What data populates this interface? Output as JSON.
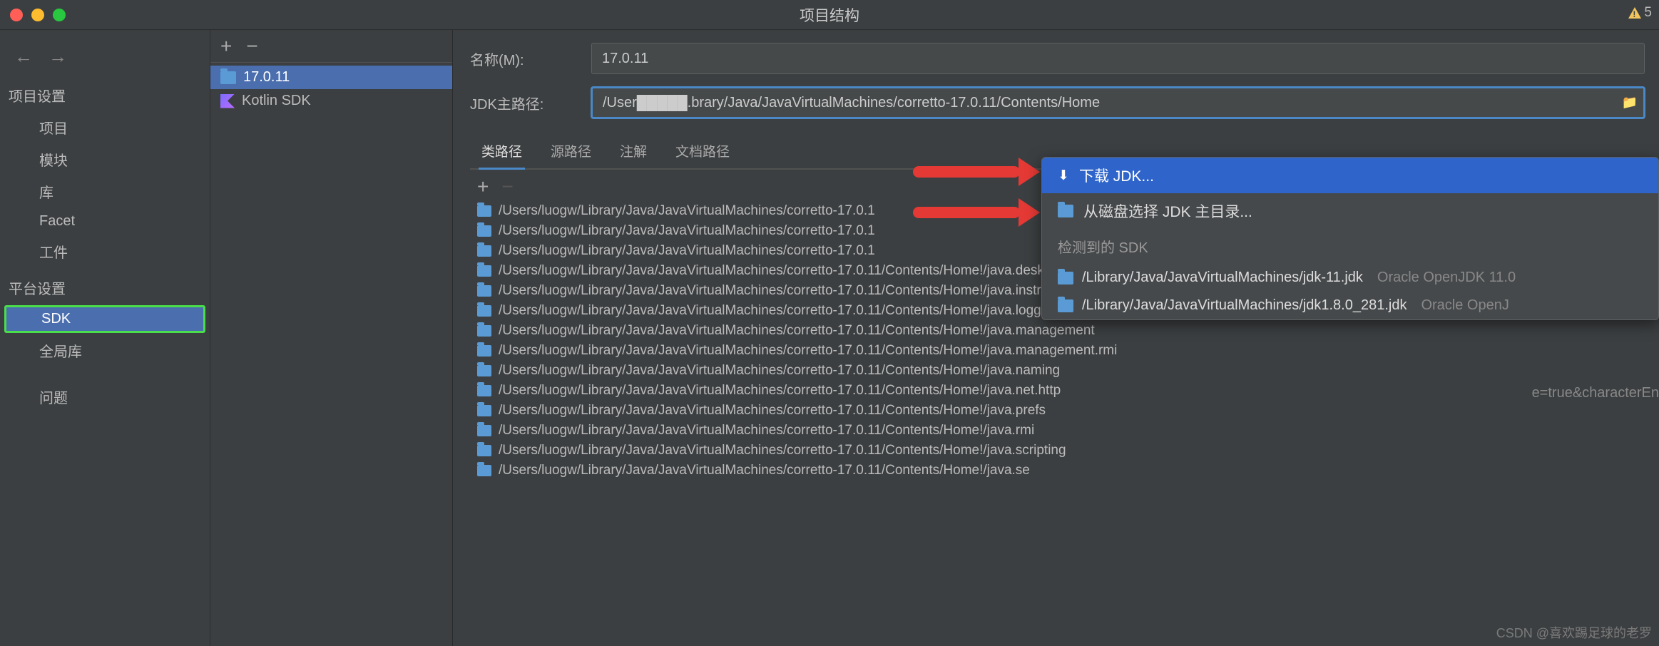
{
  "window": {
    "title": "项目结构",
    "warn_count": "5"
  },
  "sidebar": {
    "sec1": "项目设置",
    "items1": [
      "项目",
      "模块",
      "库",
      "Facet",
      "工件"
    ],
    "sec2": "平台设置",
    "items2": [
      "SDK",
      "全局库"
    ],
    "sec3_item": "问题"
  },
  "sdks": {
    "add": "+",
    "remove": "−",
    "list": [
      {
        "name": "17.0.11",
        "selected": true,
        "icon": "folder"
      },
      {
        "name": "Kotlin SDK",
        "selected": false,
        "icon": "kotlin"
      }
    ]
  },
  "form": {
    "name_label": "名称(M):",
    "name_value": "17.0.11",
    "path_label": "JDK主路径:",
    "path_value": "/User█████.brary/Java/JavaVirtualMachines/corretto-17.0.11/Contents/Home"
  },
  "tabs": [
    "类路径",
    "源路径",
    "注解",
    "文档路径"
  ],
  "list_tools": {
    "add": "+",
    "remove": "−"
  },
  "paths": [
    "/Users/luogw/Library/Java/JavaVirtualMachines/corretto-17.0.1",
    "/Users/luogw/Library/Java/JavaVirtualMachines/corretto-17.0.1",
    "/Users/luogw/Library/Java/JavaVirtualMachines/corretto-17.0.1",
    "/Users/luogw/Library/Java/JavaVirtualMachines/corretto-17.0.11/Contents/Home!/java.desktop",
    "/Users/luogw/Library/Java/JavaVirtualMachines/corretto-17.0.11/Contents/Home!/java.instrument",
    "/Users/luogw/Library/Java/JavaVirtualMachines/corretto-17.0.11/Contents/Home!/java.logging",
    "/Users/luogw/Library/Java/JavaVirtualMachines/corretto-17.0.11/Contents/Home!/java.management",
    "/Users/luogw/Library/Java/JavaVirtualMachines/corretto-17.0.11/Contents/Home!/java.management.rmi",
    "/Users/luogw/Library/Java/JavaVirtualMachines/corretto-17.0.11/Contents/Home!/java.naming",
    "/Users/luogw/Library/Java/JavaVirtualMachines/corretto-17.0.11/Contents/Home!/java.net.http",
    "/Users/luogw/Library/Java/JavaVirtualMachines/corretto-17.0.11/Contents/Home!/java.prefs",
    "/Users/luogw/Library/Java/JavaVirtualMachines/corretto-17.0.11/Contents/Home!/java.rmi",
    "/Users/luogw/Library/Java/JavaVirtualMachines/corretto-17.0.11/Contents/Home!/java.scripting",
    "/Users/luogw/Library/Java/JavaVirtualMachines/corretto-17.0.11/Contents/Home!/java.se"
  ],
  "popup": {
    "download": "下载 JDK...",
    "from_disk": "从磁盘选择 JDK 主目录...",
    "detected_hdr": "检测到的 SDK",
    "detected": [
      {
        "path": "/Library/Java/JavaVirtualMachines/jdk-11.jdk",
        "meta": "Oracle OpenJDK 11.0"
      },
      {
        "path": "/Library/Java/JavaVirtualMachines/jdk1.8.0_281.jdk",
        "meta": "Oracle OpenJ"
      }
    ]
  },
  "bg_text": "e=true&characterEn",
  "watermark": "CSDN @喜欢踢足球的老罗"
}
